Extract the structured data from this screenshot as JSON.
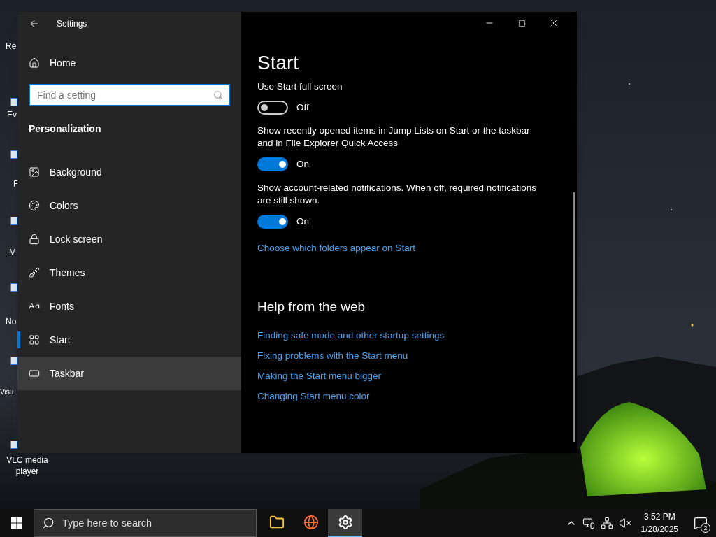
{
  "desktop": {
    "icons": [
      {
        "label": "Re"
      },
      {
        "label": "Ev"
      },
      {
        "label": "F"
      },
      {
        "label": "M"
      },
      {
        "label": "No"
      },
      {
        "label": "Visu"
      },
      {
        "label": "VLC media player"
      }
    ]
  },
  "window": {
    "title": "Settings",
    "sidebar": {
      "home": "Home",
      "search": {
        "placeholder": "Find a setting"
      },
      "section": "Personalization",
      "items": [
        {
          "kind": "background",
          "label": "Background",
          "selected": false,
          "hovered": false
        },
        {
          "kind": "colors",
          "label": "Colors",
          "selected": false,
          "hovered": false
        },
        {
          "kind": "lock-screen",
          "label": "Lock screen",
          "selected": false,
          "hovered": false
        },
        {
          "kind": "themes",
          "label": "Themes",
          "selected": false,
          "hovered": false
        },
        {
          "kind": "fonts",
          "label": "Fonts",
          "selected": false,
          "hovered": false
        },
        {
          "kind": "start",
          "label": "Start",
          "selected": true,
          "hovered": false
        },
        {
          "kind": "taskbar",
          "label": "Taskbar",
          "selected": false,
          "hovered": true
        }
      ]
    },
    "page": {
      "title": "Start",
      "settings": [
        {
          "label": "Use Start full screen",
          "on": false,
          "state_label": "Off"
        },
        {
          "label": "Show recently opened items in Jump Lists on Start or the taskbar and in File Explorer Quick Access",
          "on": true,
          "state_label": "On"
        },
        {
          "label": "Show account-related notifications. When off, required notifications are still shown.",
          "on": true,
          "state_label": "On"
        }
      ],
      "link": "Choose which folders appear on Start",
      "help_title": "Help from the web",
      "help_links": [
        "Finding safe mode and other startup settings",
        "Fixing problems with the Start menu",
        "Making the Start menu bigger",
        "Changing Start menu color"
      ]
    }
  },
  "taskbar": {
    "search": {
      "placeholder": "Type here to search"
    },
    "apps": [
      {
        "kind": "folder",
        "active": false
      },
      {
        "kind": "browser",
        "active": false
      },
      {
        "kind": "settings",
        "active": true
      }
    ],
    "time": "3:52 PM",
    "date": "1/28/2025",
    "notifications": "2"
  }
}
